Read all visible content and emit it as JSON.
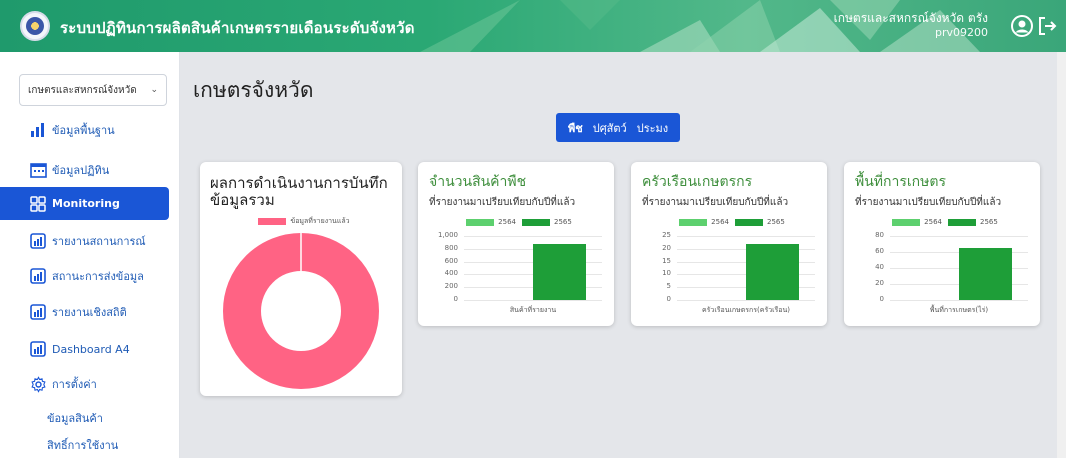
{
  "header": {
    "app_title": "ระบบปฏิทินการผลิตสินค้าเกษตรรายเดือนระดับจังหวัด",
    "user_org": "เกษตรและสหกรณ์จังหวัด ตรัง",
    "user_id": "prv09200",
    "colors": {
      "primary": "#2aa874"
    },
    "icons": [
      "user-circle-icon",
      "logout-icon"
    ]
  },
  "sidebar": {
    "org_select": "เกษตรและสหกรณ์จังหวัด",
    "items": [
      {
        "label": "ข้อมูลพื้นฐาน",
        "icon": "bar-chart-icon"
      },
      {
        "label": "ข้อมูลปฏิทิน",
        "icon": "calendar-icon"
      },
      {
        "label": "Monitoring",
        "icon": "grid-icon",
        "active": true
      },
      {
        "label": "รายงานสถานการณ์",
        "icon": "report-icon"
      },
      {
        "label": "สถานะการส่งข้อมูล",
        "icon": "report-icon"
      },
      {
        "label": "รายงานเชิงสถิติ",
        "icon": "report-icon"
      },
      {
        "label": "Dashboard A4",
        "icon": "report-icon"
      },
      {
        "label": "การตั้งค่า",
        "icon": "gear-icon"
      }
    ],
    "sub_items": [
      "ข้อมูลสินค้า",
      "สิทธิ์การใช้งาน"
    ]
  },
  "main": {
    "page_title": "เกษตรจังหวัด",
    "tabs": [
      {
        "label": "พืช",
        "active": true
      },
      {
        "label": "ปศุสัตว์"
      },
      {
        "label": "ประมง"
      }
    ],
    "summary_card": {
      "title_line1": "ผลการดำเนินงานการบันทึก",
      "title_line2": "ข้อมูลรวม",
      "legend": "ข้อมูลที่รายงานแล้ว"
    },
    "charts": [
      {
        "title": "จำนวนสินค้าพืช",
        "subtitle": "ที่รายงานมาเปรียบเทียบกับปีที่แล้ว"
      },
      {
        "title": "ครัวเรือนเกษตรกร",
        "subtitle": "ที่รายงานมาเปรียบเทียบกับปีที่แล้ว"
      },
      {
        "title": "พื้นที่การเกษตร",
        "subtitle": "ที่รายงานมาเปรียบเทียบกับปีที่แล้ว"
      }
    ]
  },
  "chart_data": [
    {
      "type": "pie",
      "labels": [
        "ข้อมูลที่รายงานแล้ว"
      ],
      "values": [
        100
      ],
      "colors": [
        "#ff6384"
      ]
    },
    {
      "type": "bar",
      "categories": [
        "สินค้าที่รายงาน"
      ],
      "series": [
        {
          "name": "2564",
          "values": [
            0
          ],
          "color": "#5dd06e"
        },
        {
          "name": "2565",
          "values": [
            880
          ],
          "color": "#1e9e38"
        }
      ],
      "yticks": [
        "1,000",
        "800",
        "600",
        "400",
        "200",
        "0"
      ],
      "ylim": [
        0,
        1000
      ]
    },
    {
      "type": "bar",
      "categories": [
        "ครัวเรือนเกษตรกร(ครัวเรือน)"
      ],
      "series": [
        {
          "name": "2564",
          "values": [
            0
          ],
          "color": "#5dd06e"
        },
        {
          "name": "2565",
          "values": [
            22
          ],
          "color": "#1e9e38"
        }
      ],
      "yticks": [
        "25",
        "20",
        "15",
        "10",
        "5",
        "0"
      ],
      "ylim": [
        0,
        25
      ]
    },
    {
      "type": "bar",
      "categories": [
        "พื้นที่การเกษตร(ไร่)"
      ],
      "series": [
        {
          "name": "2564",
          "values": [
            0
          ],
          "color": "#5dd06e"
        },
        {
          "name": "2565",
          "values": [
            65
          ],
          "color": "#1e9e38"
        }
      ],
      "yticks": [
        "80",
        "60",
        "40",
        "20",
        "0"
      ],
      "ylim": [
        0,
        80
      ]
    }
  ]
}
